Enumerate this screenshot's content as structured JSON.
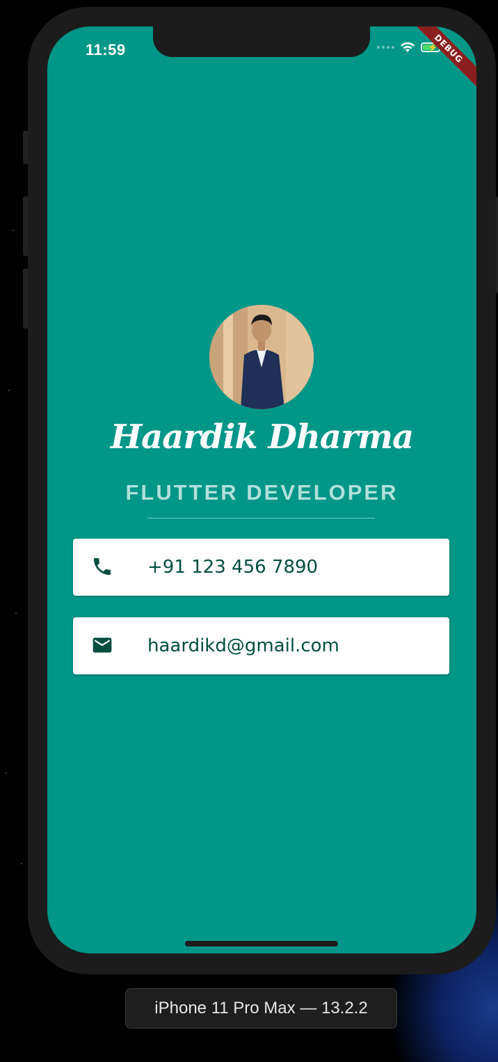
{
  "status_bar": {
    "time": "11:59",
    "icons": [
      "signal-dots-icon",
      "wifi-icon",
      "battery-charging-icon"
    ]
  },
  "debug_banner": "DEBUG",
  "profile": {
    "avatar": "profile-photo",
    "name": "Haardik Dharma",
    "title": "FLUTTER DEVELOPER"
  },
  "contacts": [
    {
      "icon": "phone-icon",
      "text": "+91 123 456 7890"
    },
    {
      "icon": "mail-icon",
      "text": "haardikd@gmail.com"
    }
  ],
  "device_label": "iPhone 11 Pro Max — 13.2.2",
  "colors": {
    "background": "#009688",
    "card": "#ffffff",
    "card_text": "#004d40",
    "title": "#b2dfdb"
  }
}
